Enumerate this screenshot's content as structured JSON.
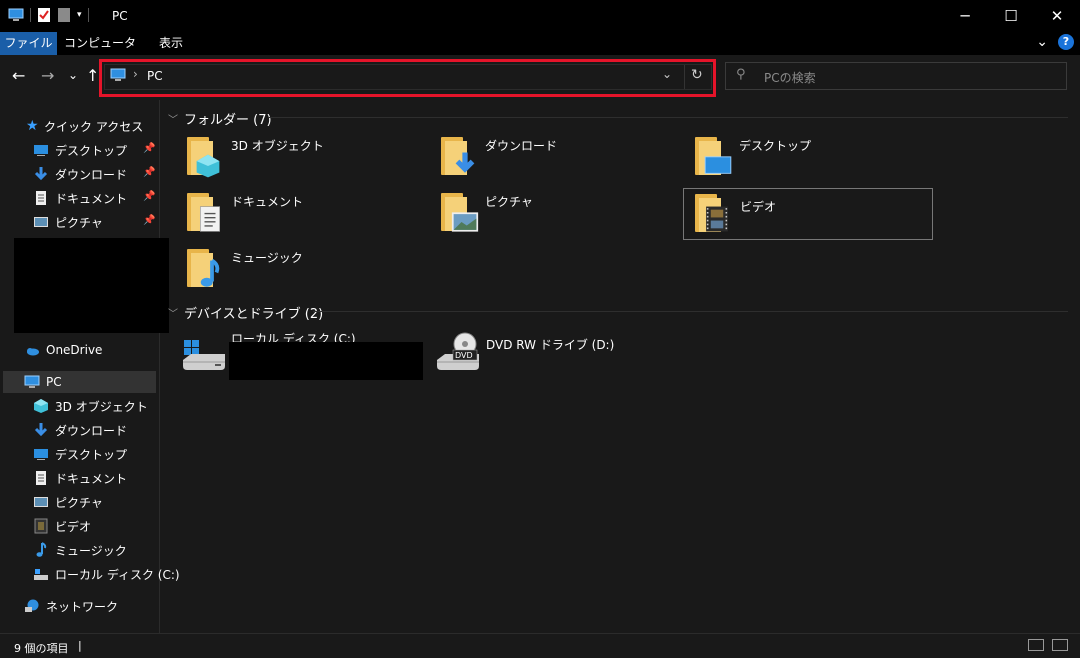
{
  "window": {
    "title": "PC",
    "minimize_glyph": "─",
    "maximize_glyph": "☐",
    "close_glyph": "✕"
  },
  "ribbon": {
    "tabs": [
      {
        "label": "ファイル",
        "active": true
      },
      {
        "label": "コンピューター",
        "active": false
      },
      {
        "label": "表示",
        "active": false
      }
    ],
    "help_label": "?",
    "expand_glyph": "⌄"
  },
  "nav": {
    "back_glyph": "←",
    "forward_glyph": "→",
    "recent_glyph": "⌄",
    "up_glyph": "↑"
  },
  "address": {
    "path": "PC",
    "separator": "›",
    "dropdown_glyph": "⌄",
    "refresh_glyph": "↻"
  },
  "search": {
    "placeholder": "PCの検索",
    "icon_glyph": "⚲"
  },
  "sidebar": {
    "quick_access": "クイック アクセス",
    "quick_items": [
      {
        "label": "デスクトップ",
        "icon": "desktop-icon"
      },
      {
        "label": "ダウンロード",
        "icon": "download-icon"
      },
      {
        "label": "ドキュメント",
        "icon": "document-icon"
      },
      {
        "label": "ピクチャ",
        "icon": "picture-icon"
      }
    ],
    "onedrive": "OneDrive",
    "pc": "PC",
    "pc_items": [
      {
        "label": "3D オブジェクト",
        "icon": "3d-objects-icon"
      },
      {
        "label": "ダウンロード",
        "icon": "download-icon"
      },
      {
        "label": "デスクトップ",
        "icon": "desktop-icon"
      },
      {
        "label": "ドキュメント",
        "icon": "document-icon"
      },
      {
        "label": "ピクチャ",
        "icon": "picture-icon"
      },
      {
        "label": "ビデオ",
        "icon": "video-icon"
      },
      {
        "label": "ミュージック",
        "icon": "music-icon"
      },
      {
        "label": "ローカル ディスク (C:)",
        "icon": "local-disk-icon"
      }
    ],
    "network": "ネットワーク",
    "pin_glyph": "📌"
  },
  "content": {
    "folders_header": "フォルダー (7)",
    "folders": [
      {
        "label": "3D オブジェクト",
        "overlay": "3d-objects-icon"
      },
      {
        "label": "ダウンロード",
        "overlay": "download-icon"
      },
      {
        "label": "デスクトップ",
        "overlay": "desktop-icon"
      },
      {
        "label": "ドキュメント",
        "overlay": "document-icon"
      },
      {
        "label": "ピクチャ",
        "overlay": "picture-icon"
      },
      {
        "label": "ビデオ",
        "overlay": "video-icon"
      },
      {
        "label": "ミュージック",
        "overlay": "music-icon"
      }
    ],
    "drives_header": "デバイスとドライブ (2)",
    "drives": [
      {
        "label": "ローカル ディスク (C:)",
        "icon": "windows-drive-icon"
      },
      {
        "label": "DVD RW ドライブ (D:)",
        "icon": "dvd-drive-icon",
        "badge": "DVD"
      }
    ]
  },
  "status": {
    "item_count": "9 個の項目"
  },
  "colors": {
    "accent": "#1a5ea8",
    "highlight_border": "#e5142a",
    "folder": "#f5d179",
    "background": "#191919"
  }
}
